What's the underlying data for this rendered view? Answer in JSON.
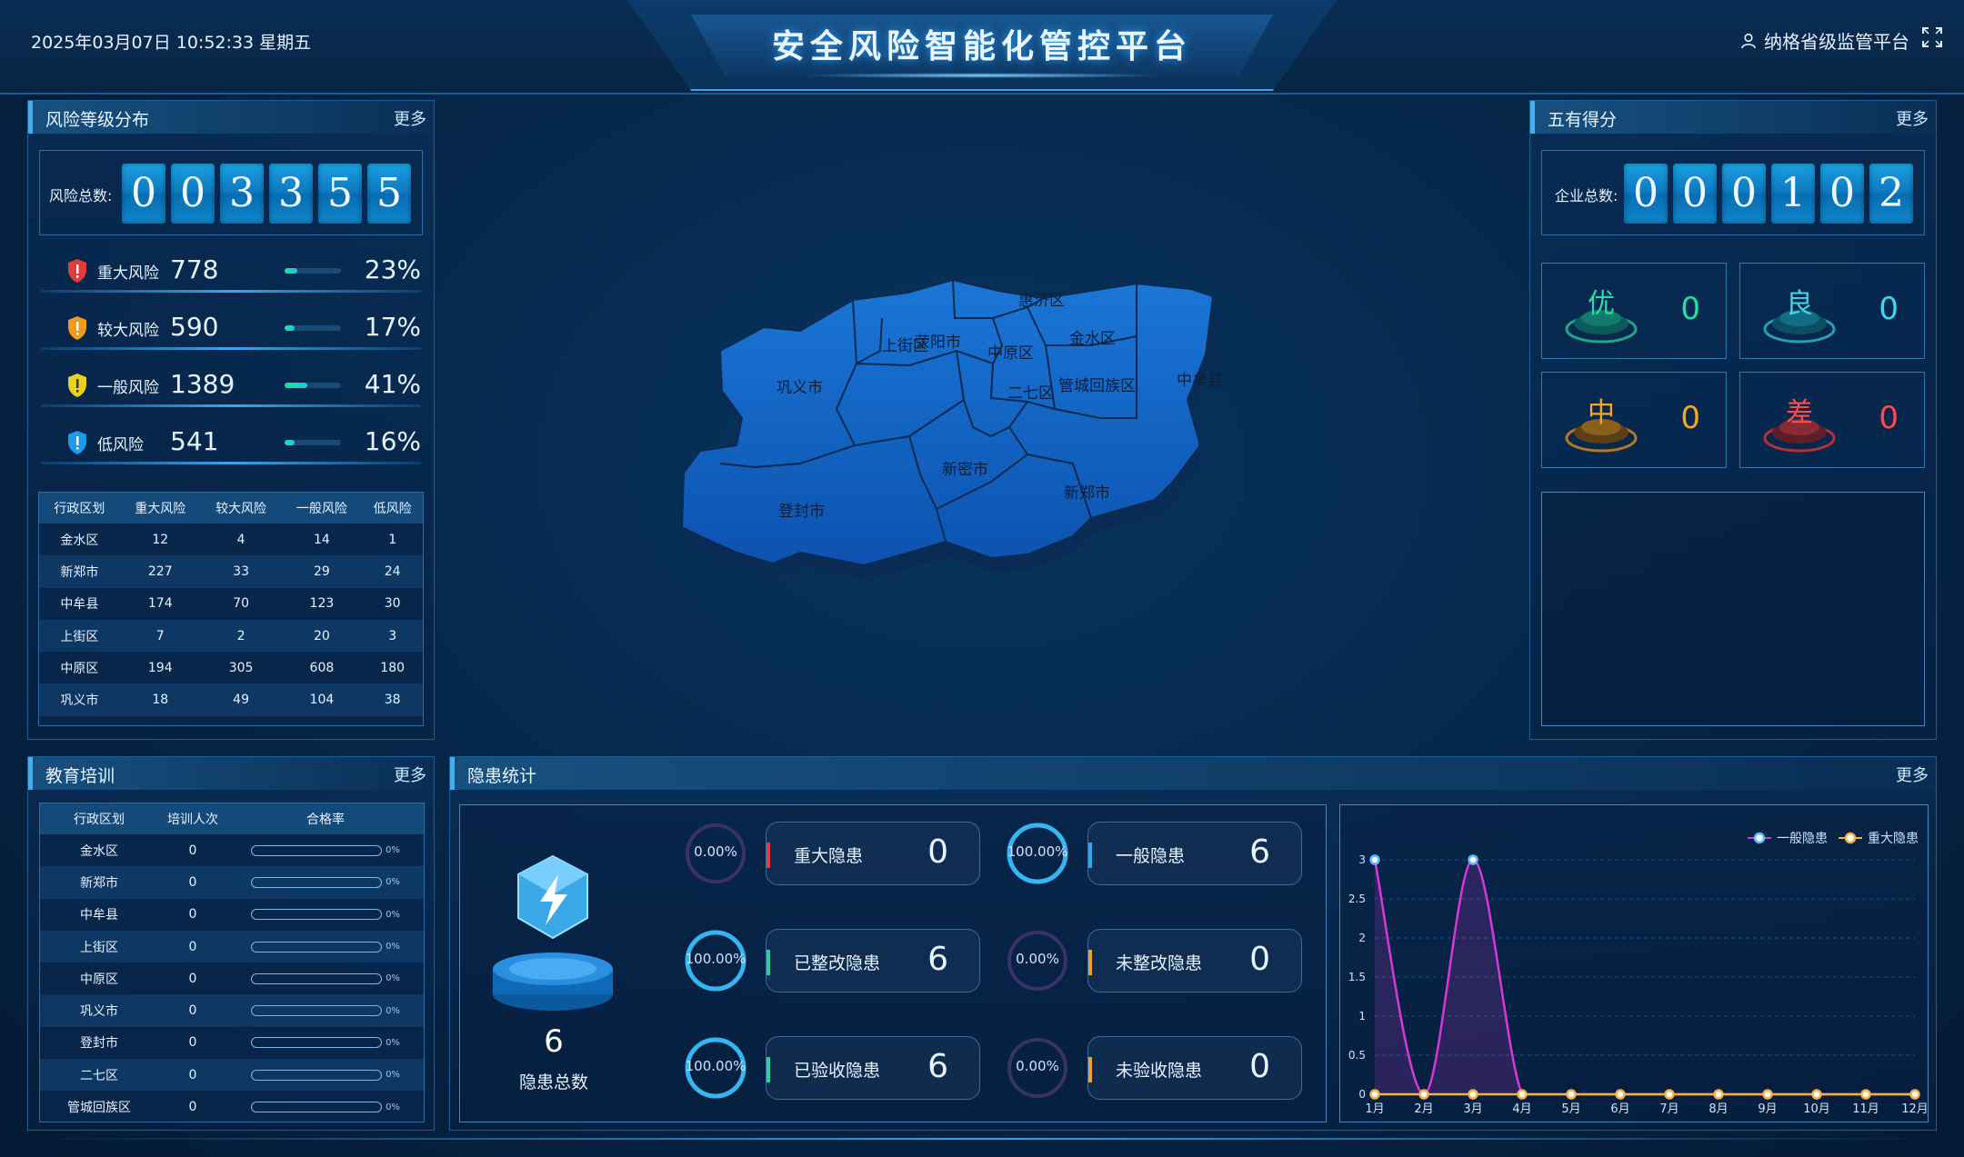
{
  "header": {
    "datetime": "2025年03月07日 10:52:33 星期五",
    "title": "安全风险智能化管控平台",
    "user": "纳格省级监管平台"
  },
  "risk_panel": {
    "title": "风险等级分布",
    "more": "更多",
    "total_label": "风险总数:",
    "total_digits": [
      "0",
      "0",
      "3",
      "3",
      "5",
      "5"
    ],
    "levels": [
      {
        "name": "重大风险",
        "count": "778",
        "pct": "23%",
        "ratio": 0.23,
        "color": "#e33b3b"
      },
      {
        "name": "较大风险",
        "count": "590",
        "pct": "17%",
        "ratio": 0.17,
        "color": "#f39a1c"
      },
      {
        "name": "一般风险",
        "count": "1389",
        "pct": "41%",
        "ratio": 0.41,
        "color": "#e8d21e"
      },
      {
        "name": "低风险",
        "count": "541",
        "pct": "16%",
        "ratio": 0.16,
        "color": "#1e9be8"
      }
    ],
    "table": {
      "headers": [
        "行政区划",
        "重大风险",
        "较大风险",
        "一般风险",
        "低风险"
      ],
      "rows": [
        [
          "金水区",
          "12",
          "4",
          "14",
          "1"
        ],
        [
          "新郑市",
          "227",
          "33",
          "29",
          "24"
        ],
        [
          "中牟县",
          "174",
          "70",
          "123",
          "30"
        ],
        [
          "上街区",
          "7",
          "2",
          "20",
          "3"
        ],
        [
          "中原区",
          "194",
          "305",
          "608",
          "180"
        ],
        [
          "巩义市",
          "18",
          "49",
          "104",
          "38"
        ]
      ]
    }
  },
  "score_panel": {
    "title": "五有得分",
    "more": "更多",
    "total_label": "企业总数:",
    "total_digits": [
      "0",
      "0",
      "0",
      "1",
      "0",
      "2"
    ],
    "grades": [
      {
        "name": "优",
        "value": "0",
        "color": "#21e0a6"
      },
      {
        "name": "良",
        "value": "0",
        "color": "#3fd6ee"
      },
      {
        "name": "中",
        "value": "0",
        "color": "#f5a623"
      },
      {
        "name": "差",
        "value": "0",
        "color": "#ff4a4a"
      }
    ]
  },
  "map": {
    "regions": [
      "惠济区",
      "金水区",
      "上街区",
      "荥阳市",
      "中原区",
      "巩义市",
      "二七区",
      "管城回族区",
      "中牟县",
      "新密市",
      "登封市",
      "新郑市"
    ]
  },
  "training_panel": {
    "title": "教育培训",
    "more": "更多",
    "headers": [
      "行政区划",
      "培训人次",
      "合格率"
    ],
    "rows": [
      {
        "region": "金水区",
        "count": "0",
        "rate": "0%",
        "ratio": 0
      },
      {
        "region": "新郑市",
        "count": "0",
        "rate": "0%",
        "ratio": 0
      },
      {
        "region": "中牟县",
        "count": "0",
        "rate": "0%",
        "ratio": 0
      },
      {
        "region": "上街区",
        "count": "0",
        "rate": "0%",
        "ratio": 0
      },
      {
        "region": "中原区",
        "count": "0",
        "rate": "0%",
        "ratio": 0
      },
      {
        "region": "巩义市",
        "count": "0",
        "rate": "0%",
        "ratio": 0
      },
      {
        "region": "登封市",
        "count": "0",
        "rate": "0%",
        "ratio": 0
      },
      {
        "region": "二七区",
        "count": "0",
        "rate": "0%",
        "ratio": 0
      },
      {
        "region": "管城回族区",
        "count": "0",
        "rate": "0%",
        "ratio": 0
      }
    ]
  },
  "hazard_panel": {
    "title": "隐患统计",
    "more": "更多",
    "total_value": "6",
    "total_label": "隐患总数",
    "stats": [
      {
        "label": "重大隐患",
        "value": "0",
        "ring": "0.00%",
        "ratio": 0,
        "bar_color": "#e43c3c"
      },
      {
        "label": "一般隐患",
        "value": "6",
        "ring": "100.00%",
        "ratio": 1,
        "bar_color": "#2fa8f0"
      },
      {
        "label": "已整改隐患",
        "value": "6",
        "ring": "100.00%",
        "ratio": 1,
        "bar_color": "#22d39a"
      },
      {
        "label": "未整改隐患",
        "value": "0",
        "ring": "0.00%",
        "ratio": 0,
        "bar_color": "#f0a225"
      },
      {
        "label": "已验收隐患",
        "value": "6",
        "ring": "100.00%",
        "ratio": 1,
        "bar_color": "#22d39a"
      },
      {
        "label": "未验收隐患",
        "value": "0",
        "ring": "0.00%",
        "ratio": 0,
        "bar_color": "#f0a225"
      }
    ]
  },
  "chart_data": {
    "type": "line",
    "categories": [
      "1月",
      "2月",
      "3月",
      "4月",
      "5月",
      "6月",
      "7月",
      "8月",
      "9月",
      "10月",
      "11月",
      "12月"
    ],
    "y_ticks": [
      "0",
      "0.5",
      "1",
      "1.5",
      "2",
      "2.5",
      "3"
    ],
    "ylim": [
      0,
      3
    ],
    "legend_position": "top-right",
    "series": [
      {
        "name": "一般隐患",
        "values": [
          3,
          0,
          3,
          0,
          0,
          0,
          0,
          0,
          0,
          0,
          0,
          0
        ],
        "color": "#d63ad6"
      },
      {
        "name": "重大隐患",
        "values": [
          0,
          0,
          0,
          0,
          0,
          0,
          0,
          0,
          0,
          0,
          0,
          0
        ],
        "color": "#f5b042"
      }
    ]
  }
}
